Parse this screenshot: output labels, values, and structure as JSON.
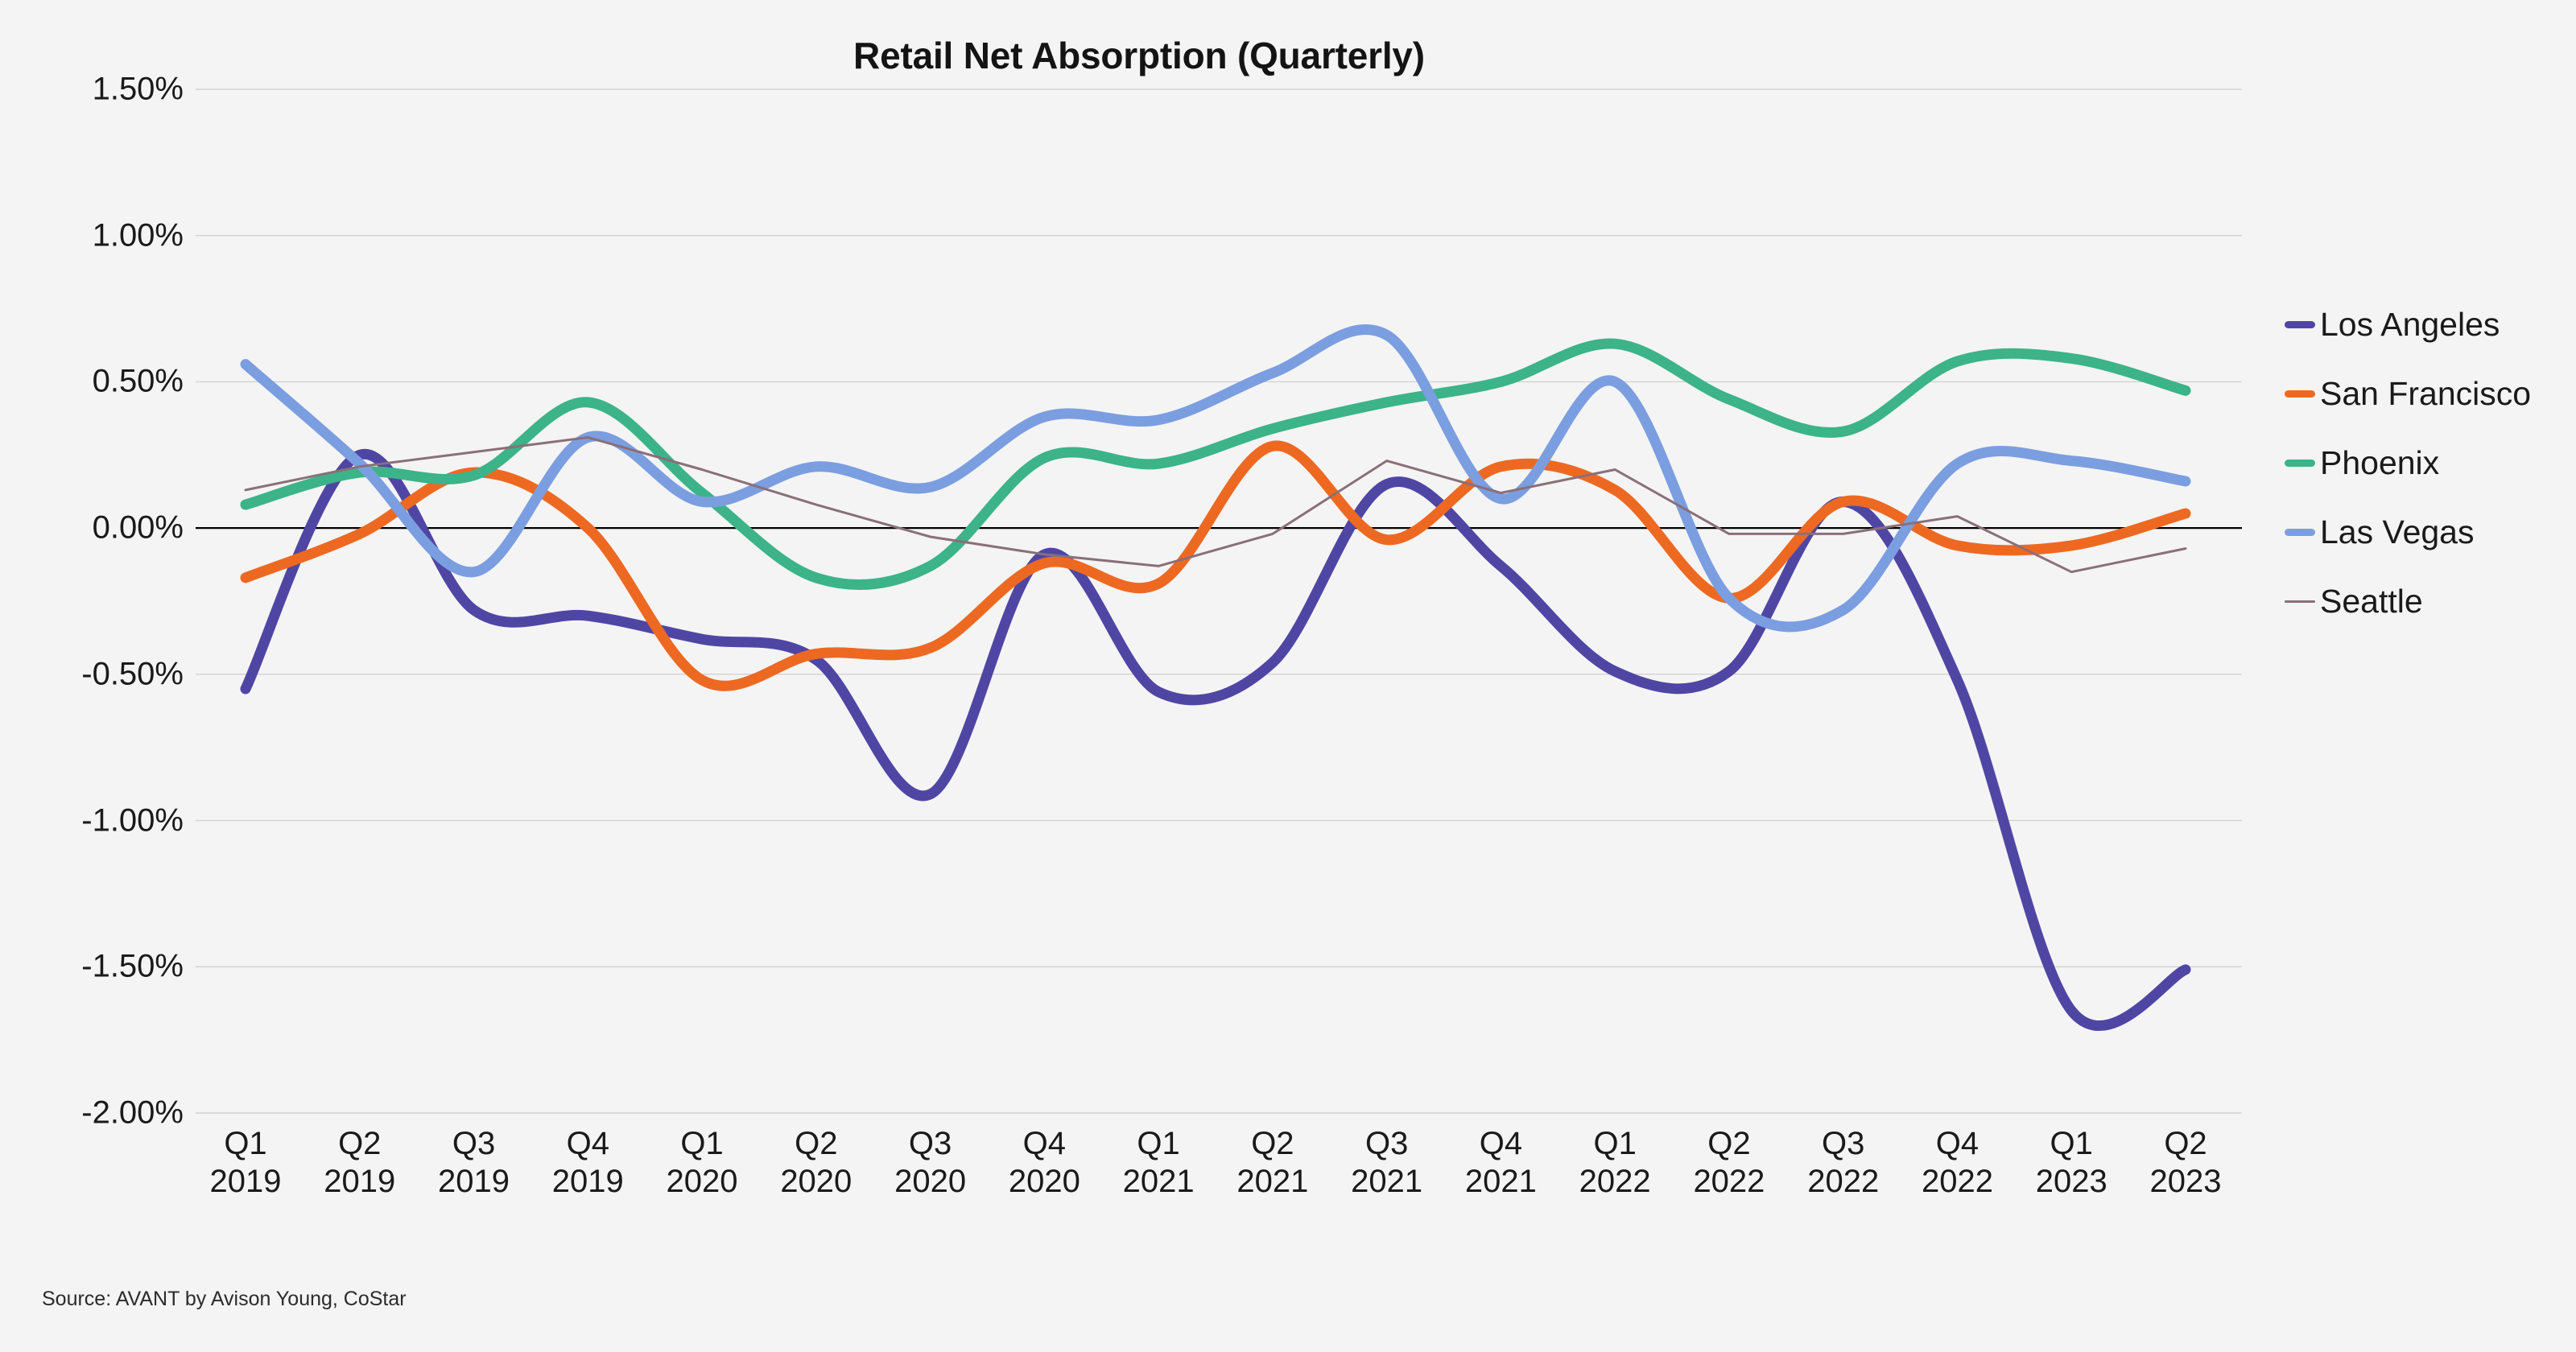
{
  "title": "Retail Net Absorption (Quarterly)",
  "source_note": "Source: AVANT by Avison Young, CoStar",
  "legend": {
    "items": [
      {
        "label": "Los Angeles",
        "color": "#4f46a4"
      },
      {
        "label": "San Francisco",
        "color": "#ed6922"
      },
      {
        "label": "Phoenix",
        "color": "#3cb389"
      },
      {
        "label": "Las Vegas",
        "color": "#7b9ee0"
      },
      {
        "label": "Seattle",
        "color": "#8a6f7a"
      }
    ]
  },
  "axes": {
    "y_ticks": [
      "1.50%",
      "1.00%",
      "0.50%",
      "0.00%",
      "-0.50%",
      "-1.00%",
      "-1.50%",
      "-2.00%"
    ],
    "y_values": [
      1.5,
      1.0,
      0.5,
      0.0,
      -0.5,
      -1.0,
      -1.5,
      -2.0
    ],
    "x_ticks": [
      {
        "quarter": "Q1",
        "year": "2019"
      },
      {
        "quarter": "Q2",
        "year": "2019"
      },
      {
        "quarter": "Q3",
        "year": "2019"
      },
      {
        "quarter": "Q4",
        "year": "2019"
      },
      {
        "quarter": "Q1",
        "year": "2020"
      },
      {
        "quarter": "Q2",
        "year": "2020"
      },
      {
        "quarter": "Q3",
        "year": "2020"
      },
      {
        "quarter": "Q4",
        "year": "2020"
      },
      {
        "quarter": "Q1",
        "year": "2021"
      },
      {
        "quarter": "Q2",
        "year": "2021"
      },
      {
        "quarter": "Q3",
        "year": "2021"
      },
      {
        "quarter": "Q4",
        "year": "2021"
      },
      {
        "quarter": "Q1",
        "year": "2022"
      },
      {
        "quarter": "Q2",
        "year": "2022"
      },
      {
        "quarter": "Q3",
        "year": "2022"
      },
      {
        "quarter": "Q4",
        "year": "2022"
      },
      {
        "quarter": "Q1",
        "year": "2023"
      },
      {
        "quarter": "Q2",
        "year": "2023"
      }
    ]
  },
  "chart_data": {
    "type": "line",
    "title": "Retail Net Absorption (Quarterly)",
    "xlabel": "",
    "ylabel": "",
    "ylim": [
      -2.0,
      1.5
    ],
    "ytick_step": 0.5,
    "grid": true,
    "legend_position": "right",
    "units": "percent",
    "smoothing": "spline",
    "categories": [
      "Q1 2019",
      "Q2 2019",
      "Q3 2019",
      "Q4 2019",
      "Q1 2020",
      "Q2 2020",
      "Q3 2020",
      "Q4 2020",
      "Q1 2021",
      "Q2 2021",
      "Q3 2021",
      "Q4 2021",
      "Q1 2022",
      "Q2 2022",
      "Q3 2022",
      "Q4 2022",
      "Q1 2023",
      "Q2 2023"
    ],
    "series": [
      {
        "name": "Los Angeles",
        "color": "#4f46a4",
        "width": "thick",
        "values": [
          -0.55,
          0.25,
          -0.28,
          -0.3,
          -0.38,
          -0.45,
          -0.91,
          -0.09,
          -0.56,
          -0.46,
          0.15,
          -0.13,
          -0.49,
          -0.49,
          0.09,
          -0.52,
          -1.65,
          -1.51
        ]
      },
      {
        "name": "San Francisco",
        "color": "#ed6922",
        "width": "thick",
        "values": [
          -0.17,
          -0.02,
          0.19,
          0.0,
          -0.52,
          -0.43,
          -0.41,
          -0.12,
          -0.19,
          0.28,
          -0.04,
          0.21,
          0.13,
          -0.24,
          0.09,
          -0.06,
          -0.06,
          0.05
        ]
      },
      {
        "name": "Phoenix",
        "color": "#3cb389",
        "width": "thick",
        "values": [
          0.08,
          0.19,
          0.18,
          0.43,
          0.12,
          -0.17,
          -0.13,
          0.24,
          0.22,
          0.34,
          0.43,
          0.5,
          0.63,
          0.44,
          0.33,
          0.57,
          0.58,
          0.47
        ]
      },
      {
        "name": "Las Vegas",
        "color": "#7b9ee0",
        "width": "thick",
        "values": [
          0.56,
          0.22,
          -0.15,
          0.31,
          0.09,
          0.21,
          0.14,
          0.38,
          0.37,
          0.53,
          0.66,
          0.1,
          0.5,
          -0.24,
          -0.28,
          0.22,
          0.23,
          0.16
        ]
      },
      {
        "name": "Seattle",
        "color": "#8a6f7a",
        "width": "thin",
        "values": [
          0.13,
          0.21,
          0.26,
          0.31,
          0.2,
          0.08,
          -0.03,
          -0.09,
          -0.13,
          -0.02,
          0.23,
          0.12,
          0.2,
          -0.02,
          -0.02,
          0.04,
          -0.15,
          -0.07
        ]
      }
    ]
  }
}
